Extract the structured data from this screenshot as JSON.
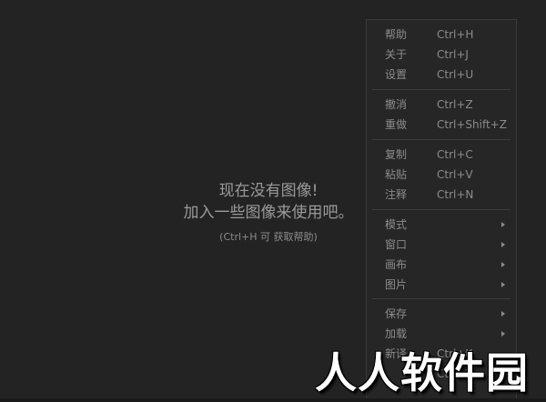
{
  "empty_state": {
    "line1": "现在没有图像!",
    "line2": "加入一些图像来使用吧。",
    "hint": "(Ctrl+H 可 获取帮助)"
  },
  "menu": {
    "items": [
      {
        "label": "帮助",
        "shortcut": "Ctrl+H"
      },
      {
        "label": "关于",
        "shortcut": "Ctrl+J"
      },
      {
        "label": "设置",
        "shortcut": "Ctrl+U"
      },
      {
        "label": "撤消",
        "shortcut": "Ctrl+Z"
      },
      {
        "label": "重做",
        "shortcut": "Ctrl+Shift+Z"
      },
      {
        "label": "复制",
        "shortcut": "Ctrl+C"
      },
      {
        "label": "粘贴",
        "shortcut": "Ctrl+V"
      },
      {
        "label": "注释",
        "shortcut": "Ctrl+N"
      },
      {
        "label": "模式",
        "shortcut": ""
      },
      {
        "label": "窗口",
        "shortcut": ""
      },
      {
        "label": "画布",
        "shortcut": ""
      },
      {
        "label": "图片",
        "shortcut": ""
      },
      {
        "label": "保存",
        "shortcut": ""
      },
      {
        "label": "加载",
        "shortcut": ""
      },
      {
        "label": "新译",
        "shortcut": "Ctrl+K"
      },
      {
        "label": "",
        "shortcut": "Ctrl+X"
      }
    ]
  },
  "watermark": {
    "text": "人人软件园"
  },
  "colors": {
    "background": "#232323",
    "menu_bg": "#262626",
    "text": "#8c8c8c",
    "separator": "#3d3d3d"
  }
}
